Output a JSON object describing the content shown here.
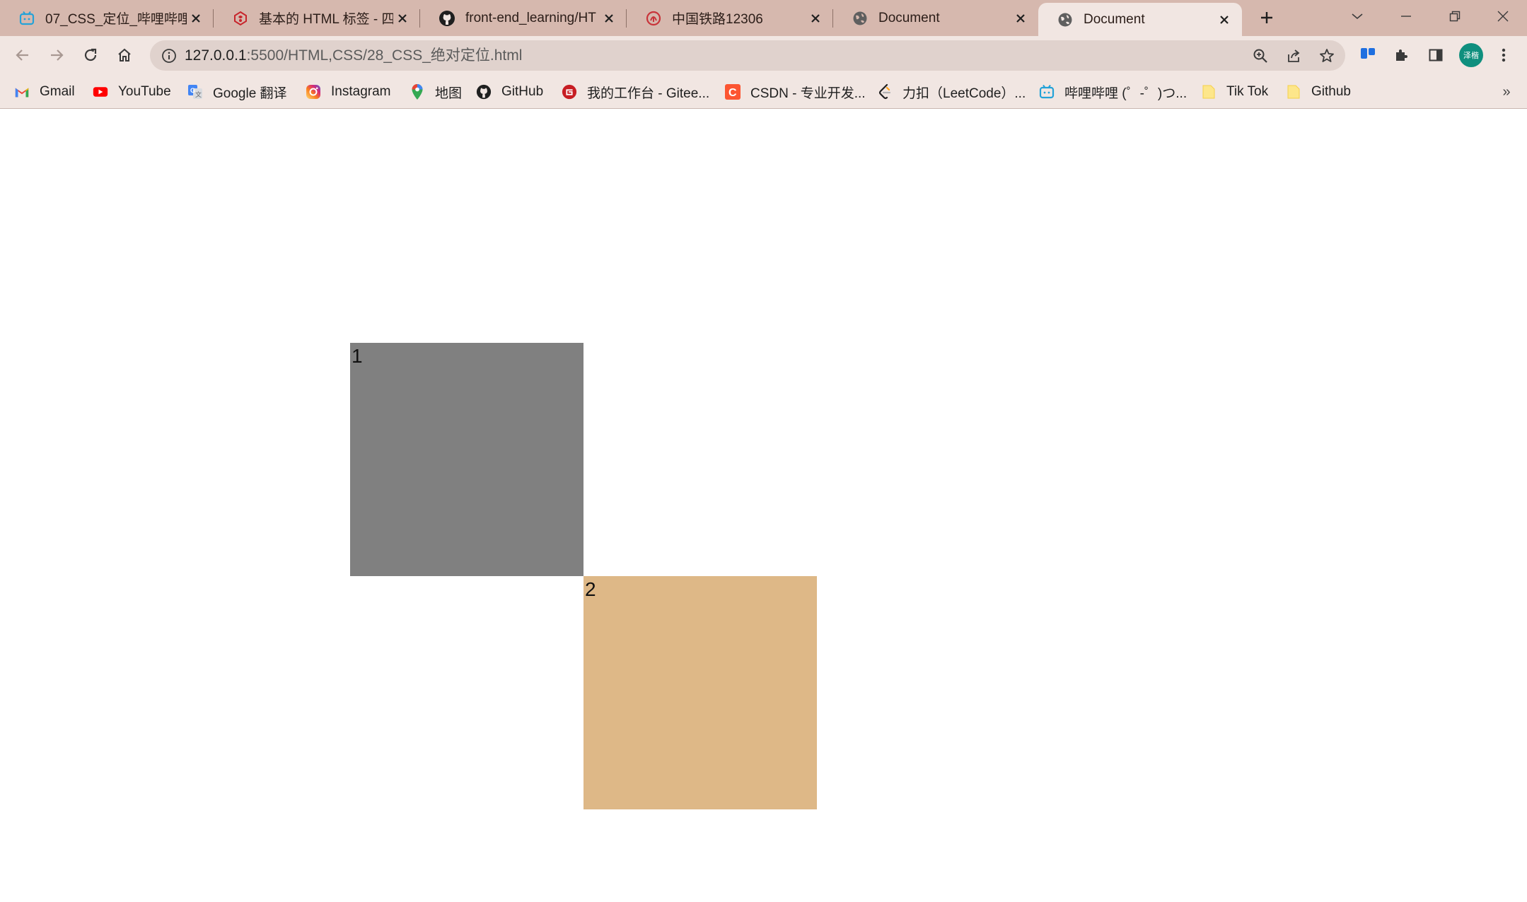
{
  "tabs": [
    {
      "title": "07_CSS_定位_哔哩哔哩_",
      "icon": "bilibili-icon"
    },
    {
      "title": "基本的 HTML 标签 - 四",
      "icon": "huawei-icon"
    },
    {
      "title": "front-end_learning/HT",
      "icon": "github-icon"
    },
    {
      "title": "中国铁路12306",
      "icon": "12306-icon"
    },
    {
      "title": "Document",
      "icon": "globe-icon"
    },
    {
      "title": "Document",
      "icon": "globe-icon",
      "active": true
    }
  ],
  "address_bar": {
    "host": "127.0.0.1",
    "path": ":5500/HTML,CSS/28_CSS_绝对定位.html"
  },
  "profile": {
    "initials": "泽楷",
    "color": "#0f8f7e"
  },
  "bookmarks": [
    {
      "label": "Gmail",
      "icon": "gmail-icon"
    },
    {
      "label": "YouTube",
      "icon": "youtube-icon"
    },
    {
      "label": "Google 翻译",
      "icon": "google-translate-icon"
    },
    {
      "label": "Instagram",
      "icon": "instagram-icon"
    },
    {
      "label": "地图",
      "icon": "maps-pin-icon"
    },
    {
      "label": "GitHub",
      "icon": "github-icon"
    },
    {
      "label": "我的工作台 - Gitee...",
      "icon": "gitee-icon"
    },
    {
      "label": "CSDN - 专业开发...",
      "icon": "csdn-icon"
    },
    {
      "label": "力扣（LeetCode）...",
      "icon": "leetcode-icon"
    },
    {
      "label": "哔哩哔哩 (゜-゜)つ...",
      "icon": "bilibili-icon"
    },
    {
      "label": "Tik Tok",
      "icon": "folder-icon"
    },
    {
      "label": "Github",
      "icon": "folder-icon"
    }
  ],
  "page": {
    "box1": {
      "text": "1",
      "color": "#808080"
    },
    "box2": {
      "text": "2",
      "color": "#deb887"
    }
  },
  "colors": {
    "tabstrip": "#d6b8ae",
    "toolbar": "#f1e6e2"
  }
}
